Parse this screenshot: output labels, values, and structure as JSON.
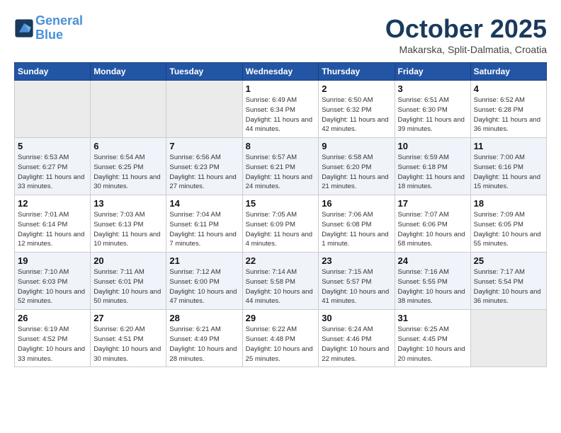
{
  "header": {
    "logo_line1": "General",
    "logo_line2": "Blue",
    "month": "October 2025",
    "location": "Makarska, Split-Dalmatia, Croatia"
  },
  "weekdays": [
    "Sunday",
    "Monday",
    "Tuesday",
    "Wednesday",
    "Thursday",
    "Friday",
    "Saturday"
  ],
  "weeks": [
    [
      {
        "day": "",
        "info": ""
      },
      {
        "day": "",
        "info": ""
      },
      {
        "day": "",
        "info": ""
      },
      {
        "day": "1",
        "info": "Sunrise: 6:49 AM\nSunset: 6:34 PM\nDaylight: 11 hours\nand 44 minutes."
      },
      {
        "day": "2",
        "info": "Sunrise: 6:50 AM\nSunset: 6:32 PM\nDaylight: 11 hours\nand 42 minutes."
      },
      {
        "day": "3",
        "info": "Sunrise: 6:51 AM\nSunset: 6:30 PM\nDaylight: 11 hours\nand 39 minutes."
      },
      {
        "day": "4",
        "info": "Sunrise: 6:52 AM\nSunset: 6:28 PM\nDaylight: 11 hours\nand 36 minutes."
      }
    ],
    [
      {
        "day": "5",
        "info": "Sunrise: 6:53 AM\nSunset: 6:27 PM\nDaylight: 11 hours\nand 33 minutes."
      },
      {
        "day": "6",
        "info": "Sunrise: 6:54 AM\nSunset: 6:25 PM\nDaylight: 11 hours\nand 30 minutes."
      },
      {
        "day": "7",
        "info": "Sunrise: 6:56 AM\nSunset: 6:23 PM\nDaylight: 11 hours\nand 27 minutes."
      },
      {
        "day": "8",
        "info": "Sunrise: 6:57 AM\nSunset: 6:21 PM\nDaylight: 11 hours\nand 24 minutes."
      },
      {
        "day": "9",
        "info": "Sunrise: 6:58 AM\nSunset: 6:20 PM\nDaylight: 11 hours\nand 21 minutes."
      },
      {
        "day": "10",
        "info": "Sunrise: 6:59 AM\nSunset: 6:18 PM\nDaylight: 11 hours\nand 18 minutes."
      },
      {
        "day": "11",
        "info": "Sunrise: 7:00 AM\nSunset: 6:16 PM\nDaylight: 11 hours\nand 15 minutes."
      }
    ],
    [
      {
        "day": "12",
        "info": "Sunrise: 7:01 AM\nSunset: 6:14 PM\nDaylight: 11 hours\nand 12 minutes."
      },
      {
        "day": "13",
        "info": "Sunrise: 7:03 AM\nSunset: 6:13 PM\nDaylight: 11 hours\nand 10 minutes."
      },
      {
        "day": "14",
        "info": "Sunrise: 7:04 AM\nSunset: 6:11 PM\nDaylight: 11 hours\nand 7 minutes."
      },
      {
        "day": "15",
        "info": "Sunrise: 7:05 AM\nSunset: 6:09 PM\nDaylight: 11 hours\nand 4 minutes."
      },
      {
        "day": "16",
        "info": "Sunrise: 7:06 AM\nSunset: 6:08 PM\nDaylight: 11 hours\nand 1 minute."
      },
      {
        "day": "17",
        "info": "Sunrise: 7:07 AM\nSunset: 6:06 PM\nDaylight: 10 hours\nand 58 minutes."
      },
      {
        "day": "18",
        "info": "Sunrise: 7:09 AM\nSunset: 6:05 PM\nDaylight: 10 hours\nand 55 minutes."
      }
    ],
    [
      {
        "day": "19",
        "info": "Sunrise: 7:10 AM\nSunset: 6:03 PM\nDaylight: 10 hours\nand 52 minutes."
      },
      {
        "day": "20",
        "info": "Sunrise: 7:11 AM\nSunset: 6:01 PM\nDaylight: 10 hours\nand 50 minutes."
      },
      {
        "day": "21",
        "info": "Sunrise: 7:12 AM\nSunset: 6:00 PM\nDaylight: 10 hours\nand 47 minutes."
      },
      {
        "day": "22",
        "info": "Sunrise: 7:14 AM\nSunset: 5:58 PM\nDaylight: 10 hours\nand 44 minutes."
      },
      {
        "day": "23",
        "info": "Sunrise: 7:15 AM\nSunset: 5:57 PM\nDaylight: 10 hours\nand 41 minutes."
      },
      {
        "day": "24",
        "info": "Sunrise: 7:16 AM\nSunset: 5:55 PM\nDaylight: 10 hours\nand 38 minutes."
      },
      {
        "day": "25",
        "info": "Sunrise: 7:17 AM\nSunset: 5:54 PM\nDaylight: 10 hours\nand 36 minutes."
      }
    ],
    [
      {
        "day": "26",
        "info": "Sunrise: 6:19 AM\nSunset: 4:52 PM\nDaylight: 10 hours\nand 33 minutes."
      },
      {
        "day": "27",
        "info": "Sunrise: 6:20 AM\nSunset: 4:51 PM\nDaylight: 10 hours\nand 30 minutes."
      },
      {
        "day": "28",
        "info": "Sunrise: 6:21 AM\nSunset: 4:49 PM\nDaylight: 10 hours\nand 28 minutes."
      },
      {
        "day": "29",
        "info": "Sunrise: 6:22 AM\nSunset: 4:48 PM\nDaylight: 10 hours\nand 25 minutes."
      },
      {
        "day": "30",
        "info": "Sunrise: 6:24 AM\nSunset: 4:46 PM\nDaylight: 10 hours\nand 22 minutes."
      },
      {
        "day": "31",
        "info": "Sunrise: 6:25 AM\nSunset: 4:45 PM\nDaylight: 10 hours\nand 20 minutes."
      },
      {
        "day": "",
        "info": ""
      }
    ]
  ]
}
